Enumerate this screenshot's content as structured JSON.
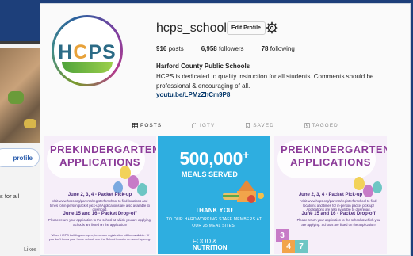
{
  "background": {
    "button_label": "profile",
    "text_line": "s for all",
    "bottom_text": "Likes"
  },
  "profile": {
    "avatar_logo_h": "H",
    "avatar_logo_o": "C",
    "avatar_logo_rest": "PS",
    "username": "hcps_schools",
    "edit_label": "Edit Profile",
    "posts_count": "916",
    "posts_label": "posts",
    "followers_count": "6,958",
    "followers_label": "followers",
    "following_count": "78",
    "following_label": "following",
    "full_name": "Harford County Public Schools",
    "bio": "HCPS is dedicated to quality instruction for all students. Comments should be professional & encouraging of all.",
    "link": "youtu.be/LPMzZhCm9P8"
  },
  "tabs": [
    {
      "label": "POSTS",
      "icon": "grid-icon"
    },
    {
      "label": "IGTV",
      "icon": "igtv-icon"
    },
    {
      "label": "SAVED",
      "icon": "bookmark-icon"
    },
    {
      "label": "TAGGED",
      "icon": "tagged-icon"
    }
  ],
  "posts": {
    "prek": {
      "title": "PREKINDERGARTEN APPLICATIONS",
      "line1": "June 2, 3, 4 - Packet Pick-up",
      "body1": "Visit www.hcps.org/parents/registerforschool to find locations and times for in-person packet pick-up! Applications are also available to download.",
      "line2": "June 15 and 16 - Packet Drop-off",
      "body2": "Please return your application to the school at which you are applying. Schools are listed on the application!",
      "note": "*When HCPS buildings re-open, in-person registration will be available. *If you don't know your home school, use the School Locator on www.hcps.org."
    },
    "meals": {
      "big": "500,000",
      "plus": "+",
      "sub": "MEALS SERVED",
      "thank": "THANK YOU",
      "thank_sub": "TO OUR HARDWORKING STAFF MEMBERS AT OUR 25 MEAL SITES!",
      "logo_top": "FOOD",
      "logo_amp": "&",
      "logo_bottom": "NUTRITION"
    }
  },
  "colors": {
    "link": "#003569",
    "prek_purple": "#8b3a98",
    "meals_blue": "#2eaee0"
  }
}
